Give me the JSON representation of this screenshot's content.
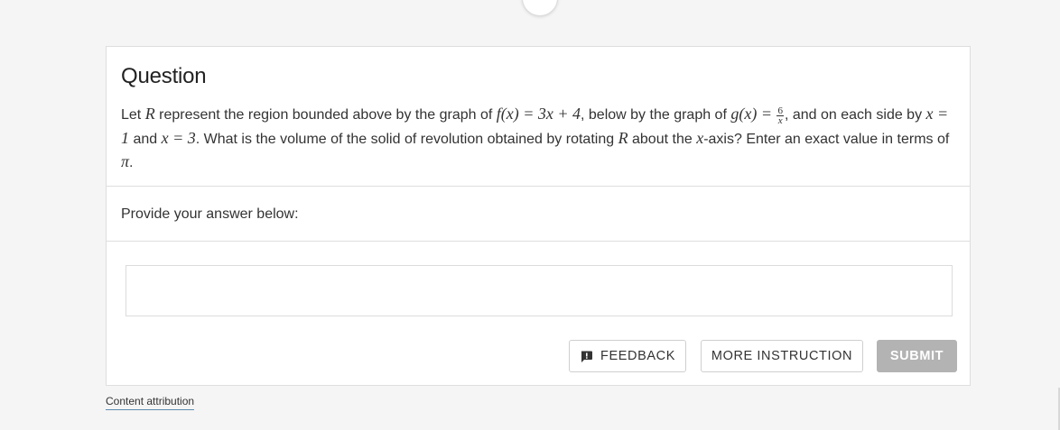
{
  "question": {
    "heading": "Question",
    "text": {
      "p1": "Let ",
      "R": "R",
      "p2": " represent the region bounded above by the graph of ",
      "f_expr": "f(x) = 3x + 4",
      "p3": ", below by the graph of ",
      "g_lhs": "g(x) = ",
      "g_num": "6",
      "g_den": "x",
      "p4": ", and on each side by ",
      "x1": "x = 1",
      "p5": " and ",
      "x2": "x = 3",
      "p6": ". What is the volume of the solid of revolution obtained by rotating ",
      "R2": "R",
      "p7": " about the ",
      "xaxis": "x",
      "p8": "-axis? Enter an exact value in terms of ",
      "pi": "π",
      "p9": "."
    }
  },
  "answer": {
    "prompt": "Provide your answer below:",
    "value": "",
    "placeholder": ""
  },
  "buttons": {
    "feedback": "FEEDBACK",
    "more_instruction": "MORE INSTRUCTION",
    "submit": "SUBMIT"
  },
  "footer": {
    "attribution": "Content attribution"
  },
  "colors": {
    "background": "#f5f5f5",
    "card": "#ffffff",
    "border": "#dedede",
    "submit_disabled": "#b3b3b3",
    "link_underline": "#5b8cb0"
  },
  "icons": {
    "feedback": "comment-alert-icon"
  }
}
